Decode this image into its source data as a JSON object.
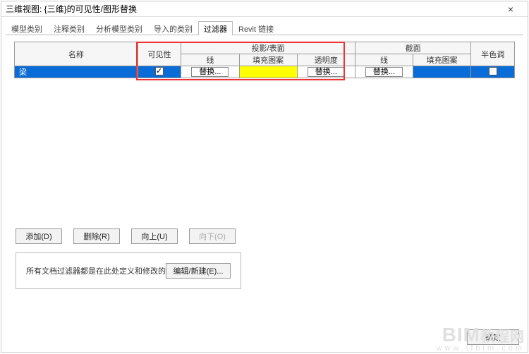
{
  "window": {
    "title": "三维视图: {三维}的可见性/图形替换",
    "close": "×"
  },
  "tabs": [
    {
      "label": "模型类别",
      "active": false
    },
    {
      "label": "注释类别",
      "active": false
    },
    {
      "label": "分析模型类别",
      "active": false
    },
    {
      "label": "导入的类别",
      "active": false
    },
    {
      "label": "过滤器",
      "active": true
    },
    {
      "label": "Revit 链接",
      "active": false
    }
  ],
  "grid": {
    "headers": {
      "name": "名称",
      "visible": "可见性",
      "projection_group": "投影/表面",
      "cut_group": "截面",
      "halftone": "半色调",
      "line": "线",
      "pattern": "填充图案",
      "transparency": "透明度"
    },
    "row": {
      "name": "梁",
      "visible": true,
      "proj_line_btn": "替换...",
      "proj_trans_btn": "替换...",
      "cut_line_btn": "替换...",
      "halftone": false
    }
  },
  "buttons": {
    "add": "添加(D)",
    "remove": "删除(R)",
    "up": "向上(U)",
    "down": "向下(O)"
  },
  "group": {
    "text": "所有文档过滤器都是在此处定义和修改的",
    "edit_btn": "编辑/新建(E)..."
  },
  "footer": {
    "ok": "确定"
  },
  "watermark": {
    "big_en": "BIM",
    "big_cn": "教程网",
    "url": "www.ifbim.com"
  }
}
